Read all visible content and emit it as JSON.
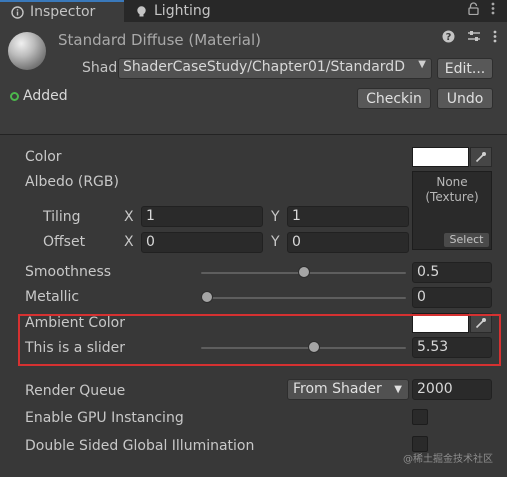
{
  "tabs": [
    {
      "label": "Inspector",
      "icon": "info-icon",
      "active": true
    },
    {
      "label": "Lighting",
      "icon": "bulb-icon",
      "active": false
    }
  ],
  "header": {
    "title": "Standard Diffuse (Material)",
    "shader_label": "Shader",
    "shader_value": "ShaderCaseStudy/Chapter01/StandardD",
    "edit_label": "Edit...",
    "added_label": "Added",
    "checkin_label": "Checkin",
    "undo_label": "Undo"
  },
  "properties": {
    "color_label": "Color",
    "albedo_label": "Albedo (RGB)",
    "tiling_label": "Tiling",
    "offset_label": "Offset",
    "x_label": "X",
    "y_label": "Y",
    "tiling_x": "1",
    "tiling_y": "1",
    "offset_x": "0",
    "offset_y": "0",
    "texture_none": "None",
    "texture_type": "(Texture)",
    "texture_select": "Select",
    "smoothness_label": "Smoothness",
    "smoothness_value": "0.5",
    "smoothness_fraction": 0.5,
    "metallic_label": "Metallic",
    "metallic_value": "0",
    "metallic_fraction": 0.0,
    "ambient_label": "Ambient Color",
    "slider_label": "This is a slider",
    "slider_value": "5.53",
    "slider_fraction": 0.553,
    "render_queue_label": "Render Queue",
    "render_queue_mode": "From Shader",
    "render_queue_value": "2000",
    "gpu_instancing_label": "Enable GPU Instancing",
    "double_sided_label": "Double Sided Global Illumination"
  },
  "watermark": "@稀土掘金技术社区",
  "colors": {
    "background": "#383838",
    "header": "#3c3c3c",
    "highlight": "#d63131",
    "swatch": "#ffffff",
    "added_dot": "#4cb84c"
  }
}
